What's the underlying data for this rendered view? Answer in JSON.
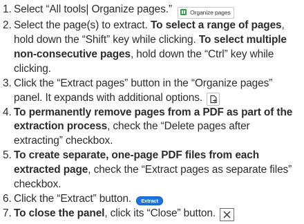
{
  "steps": [
    {
      "num": "1.",
      "parts": [
        {
          "text": "Select “All tools| Organize pages.”",
          "bold": false
        }
      ],
      "inline": {
        "kind": "badge",
        "label": "Organize pages",
        "icon": "organize-pages-icon"
      }
    },
    {
      "num": "2.",
      "parts": [
        {
          "text": "Select the page(s) to extract. ",
          "bold": false
        },
        {
          "text": "To select a range of pages",
          "bold": true
        },
        {
          "text": ", hold down the “Shift” key while clicking. ",
          "bold": false
        },
        {
          "text": "To select multiple non-consecutive pages",
          "bold": true
        },
        {
          "text": ", hold down the “Ctrl” key while clicking.",
          "bold": false
        }
      ]
    },
    {
      "num": "3.",
      "parts": [
        {
          "text": "Click the “Extract pages” button in the “Organize pages” panel. It expands with additional options.",
          "bold": false
        }
      ],
      "inline": {
        "kind": "iconbutton",
        "icon": "extract-pages-icon"
      }
    },
    {
      "num": "4.",
      "parts": [
        {
          "text": "To permanently remove pages from a PDF as part of the extraction process",
          "bold": true
        },
        {
          "text": ", check the “Delete pages after extracting” checkbox.",
          "bold": false
        }
      ]
    },
    {
      "num": "5.",
      "parts": [
        {
          "text": "To create separate, one-page PDF files from each extracted page",
          "bold": true
        },
        {
          "text": ", check the “Extract pages as separate files” checkbox.",
          "bold": false
        }
      ]
    },
    {
      "num": "6.",
      "parts": [
        {
          "text": "Click the “Extract” button.",
          "bold": false
        }
      ],
      "inline": {
        "kind": "pill",
        "label": "Extract"
      }
    },
    {
      "num": "7.",
      "parts": [
        {
          "text": "To close the panel",
          "bold": true
        },
        {
          "text": ", click its “Close” button.",
          "bold": false
        }
      ],
      "inline": {
        "kind": "close",
        "icon": "close-icon"
      }
    }
  ],
  "colors": {
    "text": "#2c2c2c",
    "accent": "#1a73e8",
    "badge_icon": "#2ea043"
  }
}
